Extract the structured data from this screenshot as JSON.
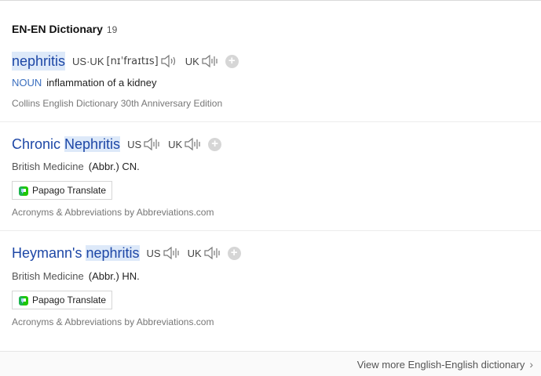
{
  "section": {
    "title": "EN-EN Dictionary",
    "count": "19"
  },
  "entries": [
    {
      "headword": "nephritis",
      "pron_region": "US·UK",
      "phonetic": "[nɪˈfraɪtɪs]",
      "uk_label": "UK",
      "pos": "NOUN",
      "definition": "inflammation of a kidney",
      "source": "Collins English Dictionary 30th Anniversary Edition"
    },
    {
      "headword_prefix": "Chronic ",
      "headword_highlight": "Nephritis",
      "us_label": "US",
      "uk_label": "UK",
      "field": "British Medicine",
      "definition": "(Abbr.) CN.",
      "papago_label": "Papago Translate",
      "source": "Acronyms & Abbreviations by Abbreviations.com"
    },
    {
      "headword_prefix": "Heymann's ",
      "headword_highlight": "nephritis",
      "us_label": "US",
      "uk_label": "UK",
      "field": "British Medicine",
      "definition": "(Abbr.) HN.",
      "papago_label": "Papago Translate",
      "source": "Acronyms & Abbreviations by Abbreviations.com"
    }
  ],
  "footer": {
    "more_label": "View more English-English dictionary"
  }
}
